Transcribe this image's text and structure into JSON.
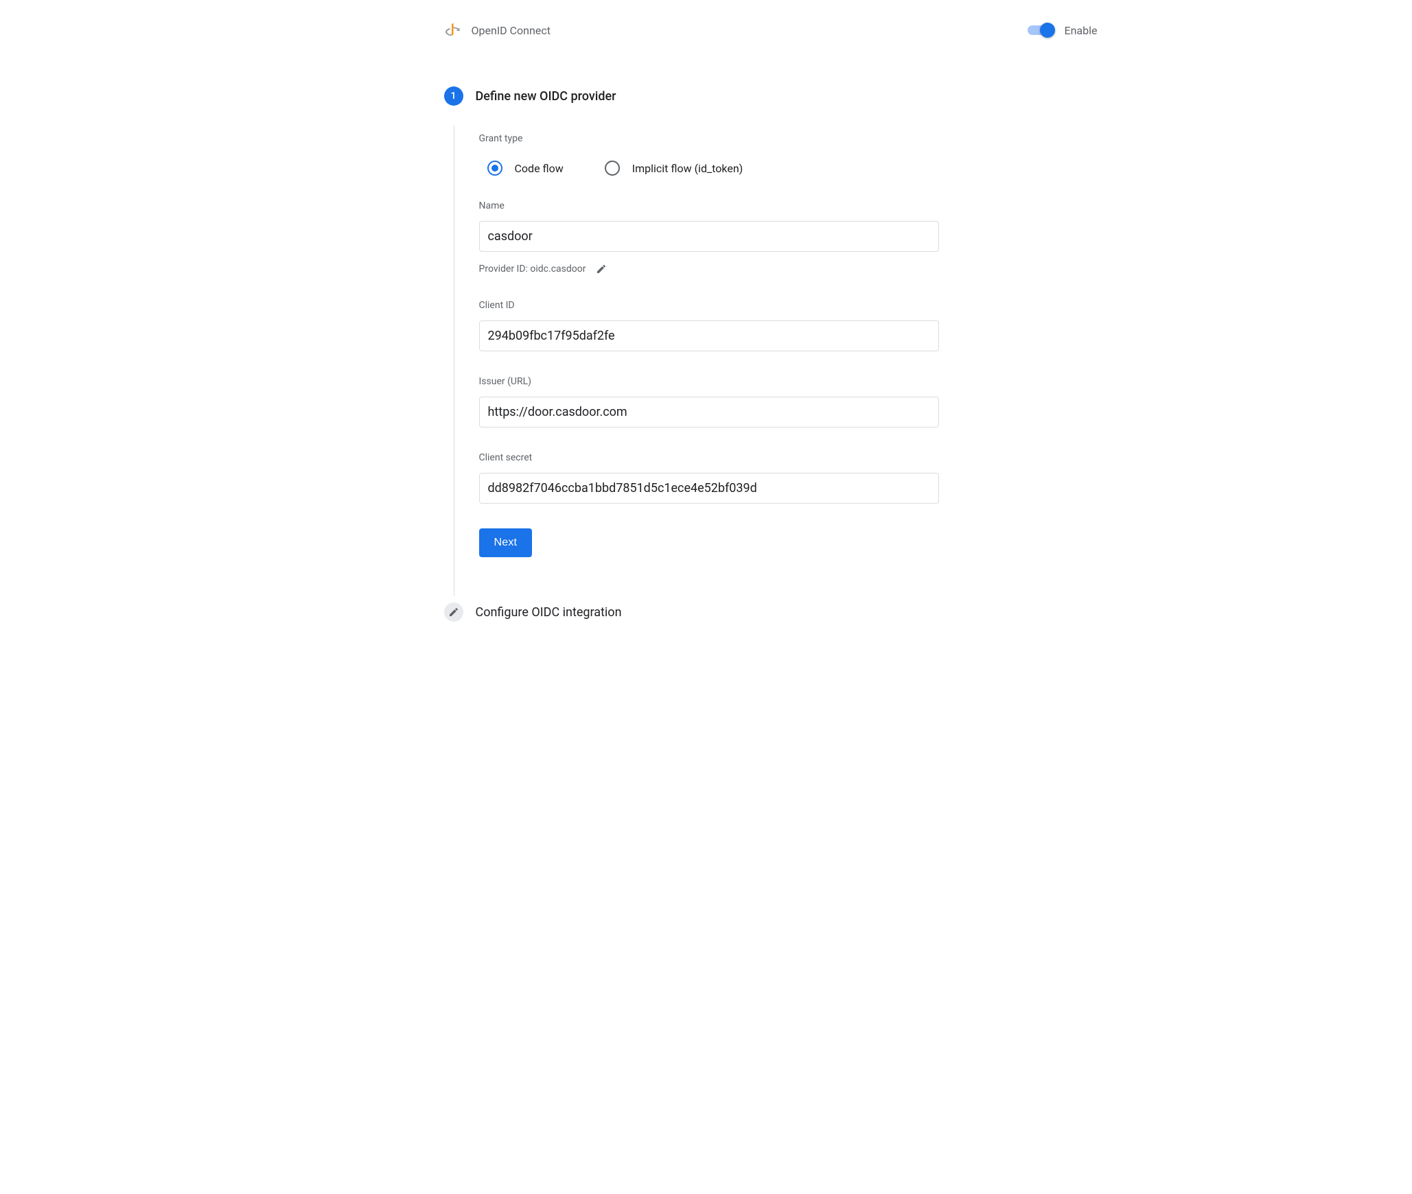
{
  "header": {
    "title": "OpenID Connect",
    "enable_label": "Enable",
    "enable_state": true
  },
  "step1": {
    "number": "1",
    "title": "Define new OIDC provider",
    "grant_type_label": "Grant type",
    "grant_options": {
      "code_flow": "Code flow",
      "implicit_flow": "Implicit flow (id_token)"
    },
    "grant_selected": "code_flow",
    "name_label": "Name",
    "name_value": "casdoor",
    "provider_id_label": "Provider ID: oidc.casdoor",
    "client_id_label": "Client ID",
    "client_id_value": "294b09fbc17f95daf2fe",
    "issuer_label": "Issuer (URL)",
    "issuer_value": "https://door.casdoor.com",
    "client_secret_label": "Client secret",
    "client_secret_value": "dd8982f7046ccba1bbd7851d5c1ece4e52bf039d",
    "next_button": "Next"
  },
  "step2": {
    "title": "Configure OIDC integration"
  }
}
